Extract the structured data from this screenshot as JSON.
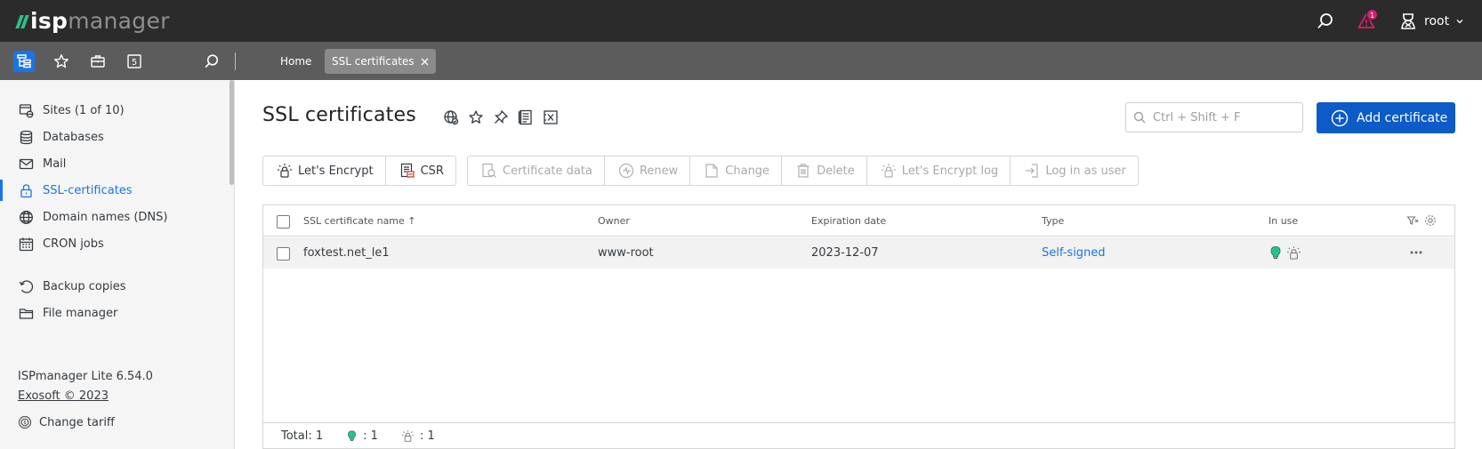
{
  "brand": {
    "isp": "isp",
    "manager": "manager"
  },
  "topbar": {
    "notifications_count": "1",
    "user_name": "root",
    "icons": [
      "search-icon",
      "bell-icon",
      "user-icon",
      "chevron-down-icon"
    ]
  },
  "subbar": {
    "icons": [
      "tree-menu-icon",
      "star-icon",
      "briefcase-icon",
      "window-five-icon",
      "search-icon"
    ],
    "window_number": "5",
    "breadcrumbs": [
      {
        "label": "Home",
        "active": false
      },
      {
        "label": "SSL certificates",
        "active": true
      }
    ]
  },
  "sidebar": {
    "items": [
      {
        "label": "Sites (1 of 10)",
        "icon": "sites-icon",
        "active": false
      },
      {
        "label": "Databases",
        "icon": "database-icon",
        "active": false
      },
      {
        "label": "Mail",
        "icon": "mail-icon",
        "active": false
      },
      {
        "label": "SSL-certificates",
        "icon": "lock-icon",
        "active": true
      },
      {
        "label": "Domain names (DNS)",
        "icon": "globe-icon",
        "active": false
      },
      {
        "label": "CRON jobs",
        "icon": "calendar-icon",
        "active": false
      },
      {
        "label": "Backup copies",
        "icon": "backup-icon",
        "active": false
      },
      {
        "label": "File manager",
        "icon": "folder-icon",
        "active": false
      }
    ],
    "version": "ISPmanager Lite 6.54.0",
    "copyright": "Exosoft © 2023",
    "change_tariff": "Change tariff"
  },
  "main": {
    "title": "SSL certificates",
    "title_icons": [
      "globe-cert-icon",
      "star-icon",
      "pin-icon",
      "document-icon",
      "excel-icon"
    ],
    "search": {
      "placeholder": "Ctrl + Shift + F",
      "value": ""
    },
    "add_button": "Add certificate",
    "toolbar": {
      "group1": [
        {
          "label": "Let's Encrypt",
          "icon": "lets-encrypt-icon",
          "enabled": true
        },
        {
          "label": "CSR",
          "icon": "csr-icon",
          "enabled": true
        }
      ],
      "group2": [
        {
          "label": "Certificate data",
          "icon": "certificate-data-icon",
          "enabled": false
        },
        {
          "label": "Renew",
          "icon": "renew-icon",
          "enabled": false
        },
        {
          "label": "Change",
          "icon": "edit-icon",
          "enabled": false
        },
        {
          "label": "Delete",
          "icon": "trash-icon",
          "enabled": false
        },
        {
          "label": "Let's Encrypt log",
          "icon": "log-icon",
          "enabled": false
        },
        {
          "label": "Log in as user",
          "icon": "login-icon",
          "enabled": false
        }
      ]
    },
    "table": {
      "columns": [
        "SSL certificate name",
        "Owner",
        "Expiration date",
        "Type",
        "In use"
      ],
      "sort_column": "SSL certificate name",
      "sort_indicator": "↑",
      "rows": [
        {
          "name": "foxtest.net_le1",
          "owner": "www-root",
          "expiration": "2023-12-07",
          "type": "Self-signed",
          "in_use_icons": [
            "lightbulb-icon",
            "lets-encrypt-icon"
          ]
        }
      ],
      "footer": {
        "total_label": "Total: 1",
        "in_use_count": ": 1",
        "le_count": ": 1"
      }
    }
  },
  "colors": {
    "accent": "#1a73e8",
    "button": "#0d5bc6",
    "topbar": "#2b2b2b",
    "subbar": "#5c5c5c",
    "brand_green": "#2fbf8a",
    "badge": "#d5206b"
  }
}
